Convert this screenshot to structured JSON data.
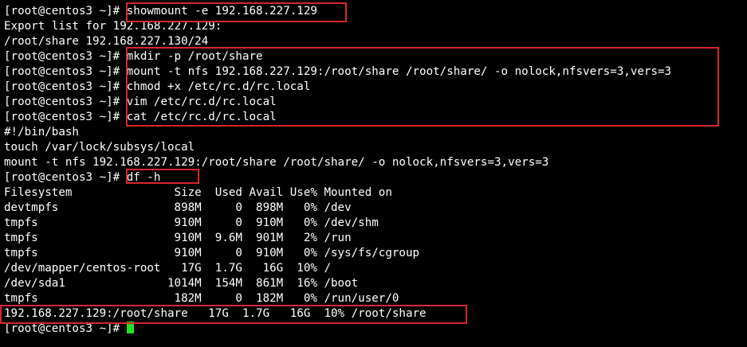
{
  "prompt": "[root@centos3 ~]# ",
  "lines": {
    "l01": {
      "prompt": "[root@centos3 ~]# ",
      "cmd": "showmount -e 192.168.227.129"
    },
    "l02": "Export list for 192.168.227.129:",
    "l03": "/root/share 192.168.227.130/24",
    "l04": {
      "prompt": "[root@centos3 ~]# ",
      "cmd": "mkdir -p /root/share"
    },
    "l05": {
      "prompt": "[root@centos3 ~]# ",
      "cmd": "mount -t nfs 192.168.227.129:/root/share /root/share/ -o nolock,nfsvers=3,vers=3"
    },
    "l06": {
      "prompt": "[root@centos3 ~]# ",
      "cmd": "chmod +x /etc/rc.d/rc.local"
    },
    "l07": {
      "prompt": "[root@centos3 ~]# ",
      "cmd": "vim /etc/rc.d/rc.local"
    },
    "l08": {
      "prompt": "[root@centos3 ~]# ",
      "cmd": "cat /etc/rc.d/rc.local"
    },
    "l09": "#!/bin/bash",
    "l10": "touch /var/lock/subsys/local",
    "l11": "mount -t nfs 192.168.227.129:/root/share /root/share/ -o nolock,nfsvers=3,vers=3",
    "l12": {
      "prompt": "[root@centos3 ~]# ",
      "cmd": "df -h"
    },
    "l13": "Filesystem               Size  Used Avail Use% Mounted on",
    "l14": "devtmpfs                 898M     0  898M   0% /dev",
    "l15": "tmpfs                    910M     0  910M   0% /dev/shm",
    "l16": "tmpfs                    910M  9.6M  901M   2% /run",
    "l17": "tmpfs                    910M     0  910M   0% /sys/fs/cgroup",
    "l18": "/dev/mapper/centos-root   17G  1.7G   16G  10% /",
    "l19": "/dev/sda1               1014M  154M  861M  16% /boot",
    "l20": "tmpfs                    182M     0  182M   0% /run/user/0",
    "l21": "192.168.227.129:/root/share   17G  1.7G   16G  10% /root/share",
    "l22": {
      "prompt": "[root@centos3 ~]# "
    }
  },
  "colors": {
    "background": "#000000",
    "text": "#ffffff",
    "highlight_box": "#d7262e",
    "cursor": "#1ee01e"
  }
}
